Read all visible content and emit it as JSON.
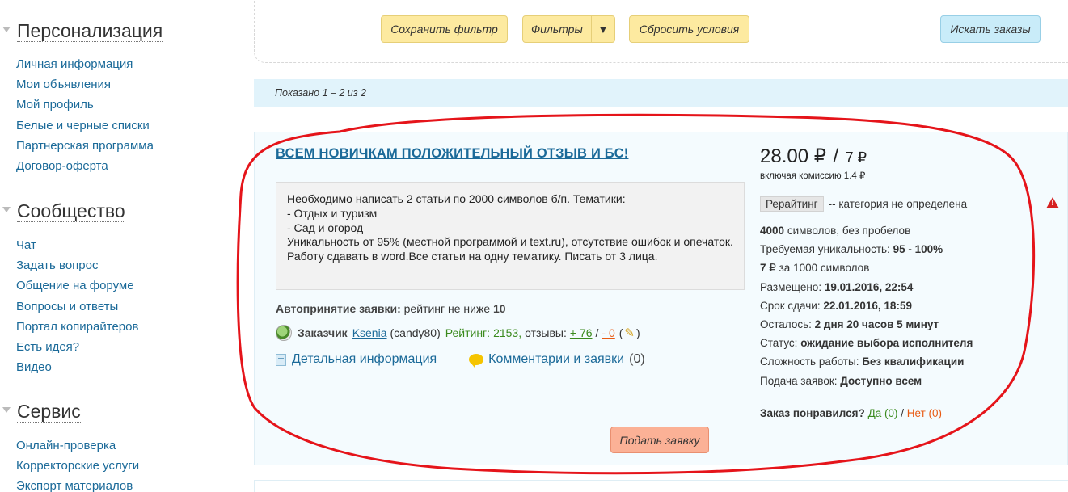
{
  "sidebar": {
    "sections": [
      {
        "title": "Персонализация",
        "items": [
          "Личная информация",
          "Мои объявления",
          "Мой профиль",
          "Белые и черные списки",
          "Партнерская программа",
          "Договор-оферта"
        ]
      },
      {
        "title": "Сообщество",
        "items": [
          "Чат",
          "Задать вопрос",
          "Общение на форуме",
          "Вопросы и ответы",
          "Портал копирайтеров",
          "Есть идея?",
          "Видео"
        ]
      },
      {
        "title": "Сервис",
        "items": [
          "Онлайн-проверка",
          "Корректорские услуги",
          "Экспорт материалов"
        ]
      }
    ]
  },
  "filters": {
    "save_label": "Сохранить фильтр",
    "filters_label": "Фильтры",
    "filters_arrow": "▼",
    "reset_label": "Сбросить условия",
    "search_label": "Искать заказы"
  },
  "results": {
    "shown_text": "Показано 1 – 2 из 2"
  },
  "order": {
    "title": "ВСЕМ НОВИЧКАМ ПОЛОЖИТЕЛЬНЫЙ ОТЗЫВ И БС!",
    "description": "Необходимо написать 2 статьи по 2000 символов б/п. Тематики:\n- Отдых и туризм\n- Сад и огород\nУникальность от 95% (местной программой и text.ru), отсутствие ошибок и опечаток. Работу сдавать в word.Все статьи на одну тематику. Писать от 3 лица.",
    "auto_accept_label": "Автопринятие заявки:",
    "auto_accept_text": "рейтинг не ниже",
    "auto_accept_value": "10",
    "customer_label": "Заказчик",
    "customer_name": "Ksenia",
    "customer_login": "(candy80)",
    "rating_label": "Рейтинг:",
    "rating_value": "2153,",
    "reviews_label": "отзывы:",
    "reviews_positive": "+ 76",
    "reviews_sep": "/",
    "reviews_negative": "- 0",
    "reviews_extra_open": "(",
    "reviews_extra_close": ")",
    "details_link": "Детальная информация",
    "comments_link": "Комментарии и заявки",
    "comments_count": "(0)",
    "price_main": "28.00 ₽",
    "price_sep": "/",
    "price_small": "7 ₽",
    "commission": "включая комиссию 1.4 ₽",
    "category_tag": "Рерайтинг",
    "category_text": "-- категория не определена",
    "specs": {
      "chars_value": "4000",
      "chars_text": "символов, без пробелов",
      "uniqueness_label": "Требуемая уникальность:",
      "uniqueness_value": "95 - 100%",
      "rate_value": "7",
      "rate_text": "₽ за 1000 символов",
      "posted_label": "Размещено:",
      "posted_value": "19.01.2016, 22:54",
      "deadline_label": "Срок сдачи:",
      "deadline_value": "22.01.2016, 18:59",
      "remaining_label": "Осталось:",
      "remaining_value": "2 дня 20 часов 5 минут",
      "status_label": "Статус:",
      "status_value": "ожидание выбора исполнителя",
      "difficulty_label": "Сложность работы:",
      "difficulty_value": "Без квалификации",
      "submission_label": "Подача заявок:",
      "submission_value": "Доступно всем"
    },
    "liked_label": "Заказ понравился?",
    "liked_yes": "Да (0)",
    "liked_sep": "/",
    "liked_no": "Нет (0)",
    "apply_label": "Подать заявку"
  },
  "colors": {
    "link": "#1b6a99",
    "accent_red": "#e5141a",
    "deadline": "#e85a12",
    "positive": "#3a8a1d"
  },
  "icons": [
    "triangle-down-icon",
    "avatar-icon",
    "pencil-icon",
    "document-icon",
    "comment-bubble-icon",
    "warning-icon"
  ]
}
